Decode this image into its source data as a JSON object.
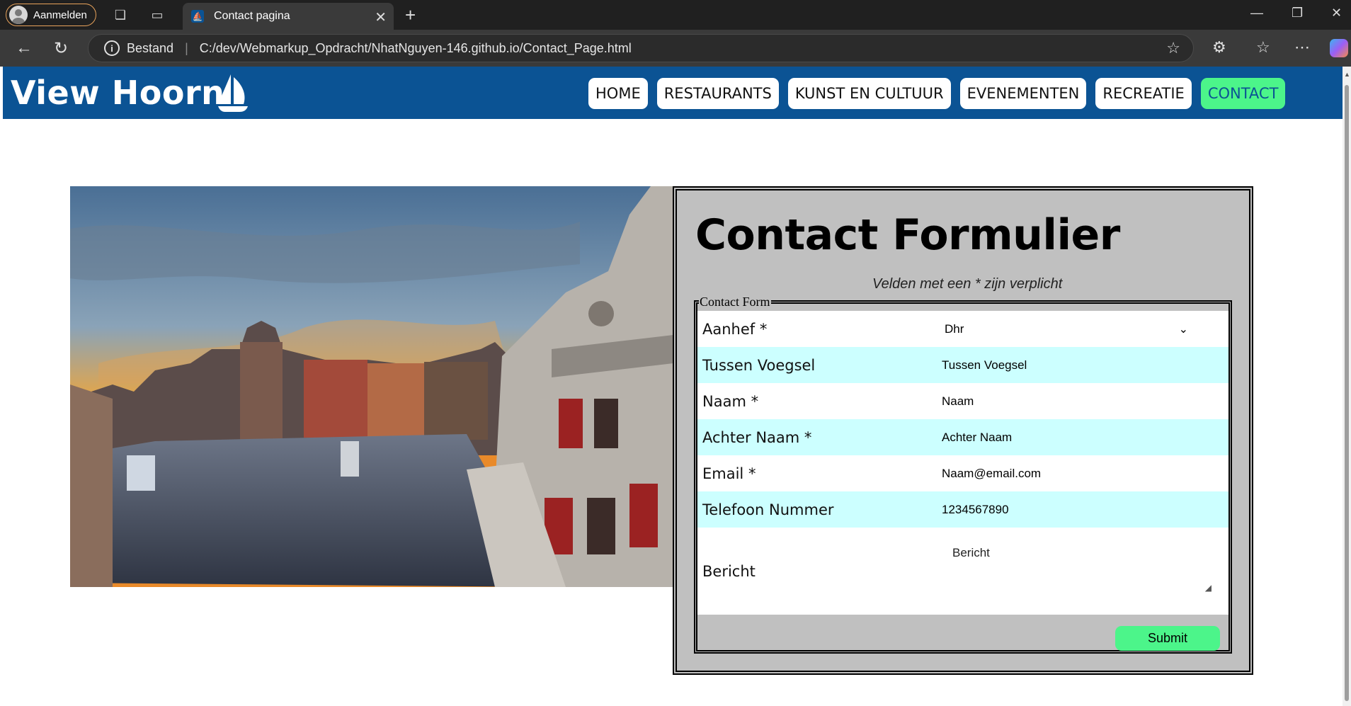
{
  "browser": {
    "profile_label": "Aanmelden",
    "tab_title": "Contact pagina",
    "address_prefix": "Bestand",
    "url": "C:/dev/Webmarkup_Opdracht/NhatNguyen-146.github.io/Contact_Page.html"
  },
  "site": {
    "logo": "View Hoorn",
    "nav": [
      {
        "label": "HOME",
        "active": false
      },
      {
        "label": "RESTAURANTS",
        "active": false
      },
      {
        "label": "KUNST EN CULTUUR",
        "active": false
      },
      {
        "label": "EVENEMENTEN",
        "active": false
      },
      {
        "label": "RECREATIE",
        "active": false
      },
      {
        "label": "CONTACT",
        "active": true
      }
    ]
  },
  "form": {
    "title": "Contact Formulier",
    "note": "Velden met een * zijn verplicht",
    "legend": "Contact Form",
    "fields": {
      "aanhef": {
        "label": "Aanhef *",
        "value": "Dhr"
      },
      "tussen": {
        "label": "Tussen Voegsel",
        "placeholder": "Tussen Voegsel"
      },
      "naam": {
        "label": "Naam *",
        "placeholder": "Naam"
      },
      "achternaam": {
        "label": "Achter Naam *",
        "placeholder": "Achter Naam"
      },
      "email": {
        "label": "Email *",
        "placeholder": "Naam@email.com"
      },
      "telefoon": {
        "label": "Telefoon Nummer",
        "placeholder": "1234567890"
      },
      "bericht": {
        "label": "Bericht",
        "placeholder": "Bericht"
      }
    },
    "submit_label": "Submit"
  },
  "colors": {
    "header_blue": "#0b5394",
    "accent_green": "#4cf58a",
    "row_cyan": "#ccffff",
    "form_gray": "#c0c0c0"
  }
}
